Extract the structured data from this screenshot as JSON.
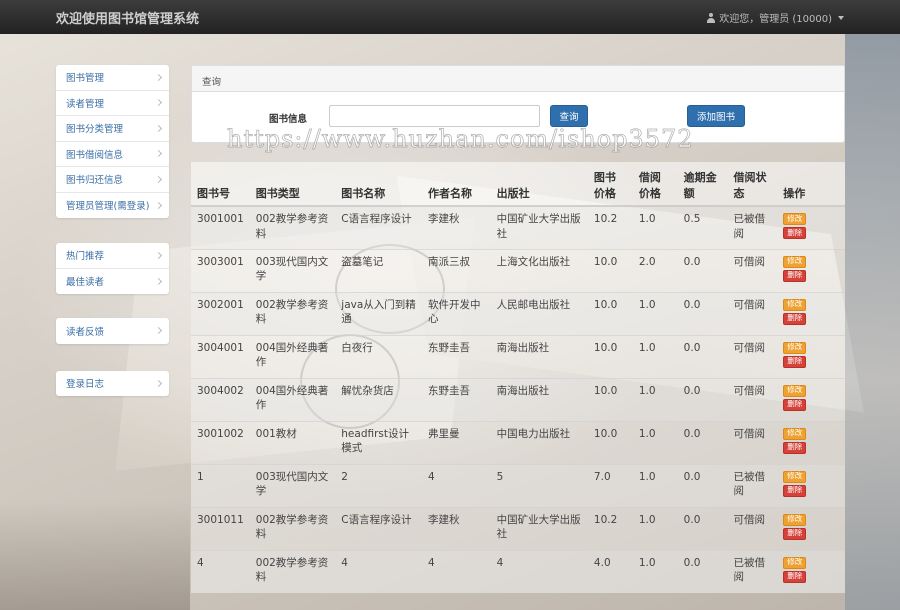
{
  "header": {
    "title": "欢迎使用图书馆管理系统",
    "user_text": "欢迎您，管理员 (10000)"
  },
  "sidebar": {
    "groups": [
      {
        "items": [
          {
            "label": "图书管理"
          },
          {
            "label": "读者管理"
          },
          {
            "label": "图书分类管理"
          },
          {
            "label": "图书借阅信息"
          },
          {
            "label": "图书归还信息"
          },
          {
            "label": "管理员管理(需登录)"
          }
        ]
      },
      {
        "items": [
          {
            "label": "热门推荐"
          },
          {
            "label": "最佳读者"
          }
        ]
      },
      {
        "items": [
          {
            "label": "读者反馈"
          }
        ]
      },
      {
        "items": [
          {
            "label": "登录日志"
          }
        ]
      }
    ]
  },
  "query_panel": {
    "heading": "查询",
    "field_label": "图书信息",
    "field_value": "",
    "field_placeholder": "",
    "search_button": "查询",
    "add_button": "添加图书"
  },
  "watermark": "https://www.huzhan.com/ishop3572",
  "table": {
    "headers": [
      "图书号",
      "图书类型",
      "图书名称",
      "作者名称",
      "出版社",
      "图书价格",
      "借阅价格",
      "逾期金额",
      "借阅状态",
      "操作"
    ],
    "edit_label": "修改",
    "delete_label": "删除",
    "rows": [
      [
        "3001001",
        "002教学参考资料",
        "C语言程序设计",
        "李建秋",
        "中国矿业大学出版社",
        "10.2",
        "1.0",
        "0.5",
        "已被借阅"
      ],
      [
        "3003001",
        "003现代国内文学",
        "盗墓笔记",
        "南派三叔",
        "上海文化出版社",
        "10.0",
        "2.0",
        "0.0",
        "可借阅"
      ],
      [
        "3002001",
        "002教学参考资料",
        "java从入门到精通",
        "软件开发中心",
        "人民邮电出版社",
        "10.0",
        "1.0",
        "0.0",
        "可借阅"
      ],
      [
        "3004001",
        "004国外经典著作",
        "白夜行",
        "东野圭吾",
        "南海出版社",
        "10.0",
        "1.0",
        "0.0",
        "可借阅"
      ],
      [
        "3004002",
        "004国外经典著作",
        "解忧杂货店",
        "东野圭吾",
        "南海出版社",
        "10.0",
        "1.0",
        "0.0",
        "可借阅"
      ],
      [
        "3001002",
        "001教材",
        "headfirst设计模式",
        "弗里曼",
        "中国电力出版社",
        "10.0",
        "1.0",
        "0.0",
        "可借阅"
      ],
      [
        "1",
        "003现代国内文学",
        "2",
        "4",
        "5",
        "7.0",
        "1.0",
        "0.0",
        "已被借阅"
      ],
      [
        "3001011",
        "002教学参考资料",
        "C语言程序设计",
        "李建秋",
        "中国矿业大学出版社",
        "10.2",
        "1.0",
        "0.0",
        "可借阅"
      ],
      [
        "4",
        "002教学参考资料",
        "4",
        "4",
        "4",
        "4.0",
        "1.0",
        "0.0",
        "已被借阅"
      ]
    ]
  },
  "colors": {
    "navbar": "#222222",
    "primary_button": "#2f6fae",
    "edit_button": "#efa131",
    "delete_button": "#d6423a",
    "sidebar_link": "#3a6ea5"
  }
}
